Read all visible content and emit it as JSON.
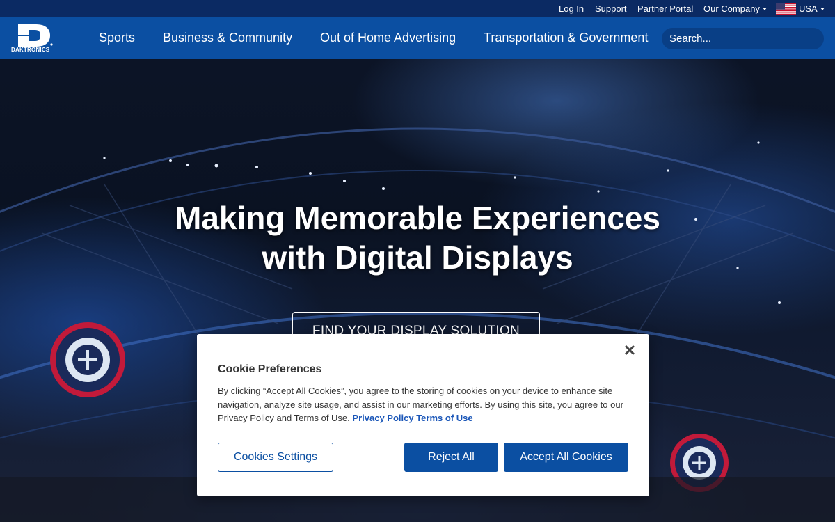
{
  "utility_nav": {
    "items": [
      {
        "label": "Log In"
      },
      {
        "label": "Support"
      },
      {
        "label": "Partner Portal"
      },
      {
        "label": "Our Company",
        "dropdown": true
      }
    ],
    "region": {
      "label": "USA",
      "icon": "us-flag-icon"
    }
  },
  "brand": {
    "logo_text": "DAKTRONICS",
    "logo_mark_icon": "daktronics-d-logo"
  },
  "main_nav": {
    "items": [
      {
        "label": "Sports"
      },
      {
        "label": "Business & Community"
      },
      {
        "label": "Out of Home Advertising"
      },
      {
        "label": "Transportation & Government"
      }
    ],
    "search": {
      "placeholder": "Search..."
    }
  },
  "hero": {
    "title_line1": "Making Memorable Experiences",
    "title_line2": "with Digital Displays",
    "cta_label": "FIND YOUR DISPLAY SOLUTION"
  },
  "cookie_modal": {
    "close_icon": "close-icon",
    "title": "Cookie Preferences",
    "body": "By clicking “Accept All Cookies”, you agree to the storing of cookies on your device to enhance site navigation, analyze site usage, and assist in our marketing efforts. By using this site, you agree to our Privacy Policy and Terms of Use.",
    "privacy_link": "Privacy Policy",
    "terms_link": "Terms of Use",
    "settings_button": "Cookies Settings",
    "reject_button": "Reject All",
    "accept_button": "Accept All Cookies"
  },
  "colors": {
    "utility_bar": "#0b2a63",
    "nav_bar": "#0b4fa2",
    "primary_button": "#0b4fa2",
    "link": "#1a56b8"
  }
}
